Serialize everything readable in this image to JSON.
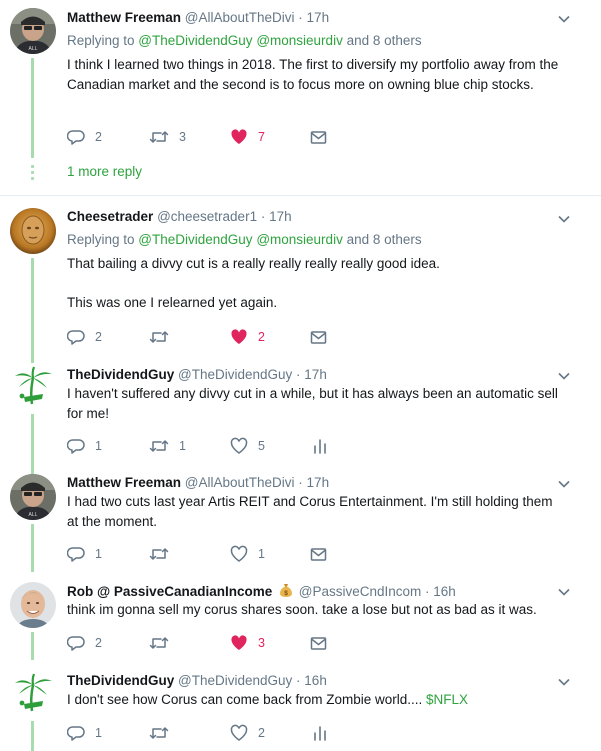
{
  "tweets": [
    {
      "name": "Matthew Freeman",
      "handle": "@AllAboutTheDivi",
      "time": "17h",
      "reply_prefix": "Replying to ",
      "reply_user1": "@TheDividendGuy",
      "reply_user2": "@monsieurdiv",
      "reply_suffix": " and 8 others",
      "text": [
        "I think I learned two things in 2018. The first to diversify my portfolio away from the Canadian market and the second is to focus more on owning blue chip stocks."
      ],
      "replies": "2",
      "retweets": "3",
      "likes": "7",
      "more_reply": "1 more reply"
    },
    {
      "name": "Cheesetrader",
      "handle": "@cheesetrader1",
      "time": "17h",
      "reply_prefix": "Replying to ",
      "reply_user1": "@TheDividendGuy",
      "reply_user2": "@monsieurdiv",
      "reply_suffix": " and 8 others",
      "text": [
        "That bailing a divvy cut is a really really really really good idea.",
        "This was one I relearned yet again."
      ],
      "replies": "2",
      "retweets": "",
      "likes": "2"
    },
    {
      "name": "TheDividendGuy",
      "handle": "@TheDividendGuy",
      "time": "17h",
      "text": [
        "I haven't suffered any divvy cut in a while, but it has always been an automatic sell for me!"
      ],
      "replies": "1",
      "retweets": "1",
      "likes": "5"
    },
    {
      "name": "Matthew Freeman",
      "handle": "@AllAboutTheDivi",
      "time": "17h",
      "text": [
        "I had two cuts last year Artis REIT and Corus Entertainment. I'm still holding them at the moment."
      ],
      "replies": "1",
      "retweets": "",
      "likes": "1"
    },
    {
      "name": "Rob @ PassiveCanadianIncome",
      "handle": "@PassiveCndIncom",
      "time": "16h",
      "text": [
        "think im gonna sell my corus shares soon. take a lose but not as bad as it was."
      ],
      "replies": "2",
      "retweets": "",
      "likes": "3"
    },
    {
      "name": "TheDividendGuy",
      "handle": "@TheDividendGuy",
      "time": "16h",
      "text": [
        "I don't see how Corus can come back from Zombie world.... "
      ],
      "cashtag": "$NFLX",
      "replies": "1",
      "retweets": "",
      "likes": "2"
    }
  ],
  "dot": " · ",
  "colors": {
    "accent": "#2ea33e",
    "like": "#e0245e",
    "thread": "#a8dcae",
    "muted": "#657786"
  }
}
